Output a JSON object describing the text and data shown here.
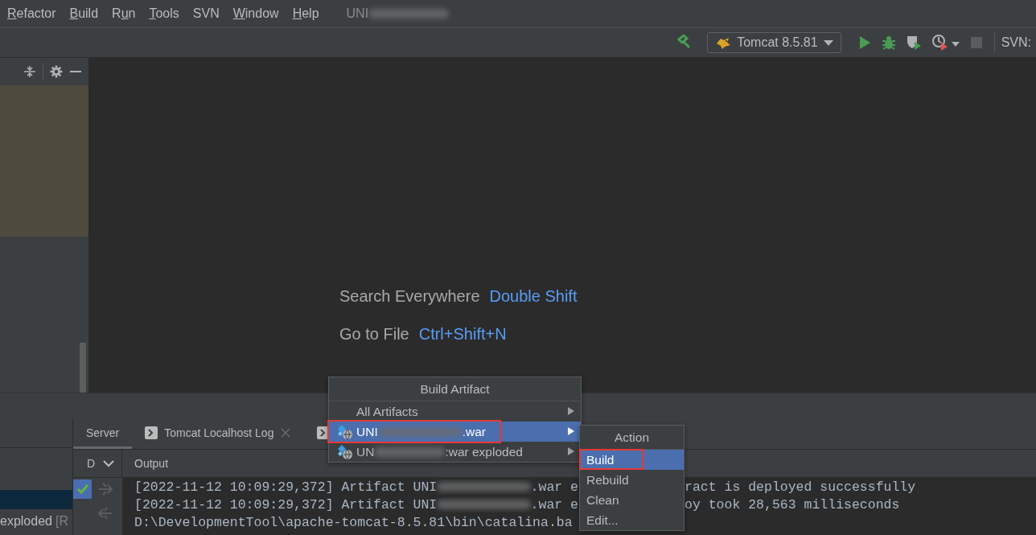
{
  "menu_bar": {
    "items": [
      {
        "key": "R",
        "post": "efactor"
      },
      {
        "key": "B",
        "post": "uild"
      },
      {
        "pre": "R",
        "key": "u",
        "post": "n"
      },
      {
        "key": "T",
        "post": "ools"
      },
      {
        "post": "SVN"
      },
      {
        "key": "W",
        "post": "indow"
      },
      {
        "key": "H",
        "post": "elp"
      }
    ],
    "project_title": {
      "start": "UNI",
      "blurred": true
    }
  },
  "toolbar": {
    "run_config": "Tomcat 8.5.81",
    "stop_disabled": true,
    "vcs_label": "SVN:"
  },
  "editor": {
    "hints": [
      {
        "label": "Search Everywhere",
        "shortcut": "Double Shift"
      },
      {
        "label": "Go to File",
        "shortcut": "Ctrl+Shift+N"
      }
    ]
  },
  "services": {
    "tabs": [
      {
        "label": "Server",
        "selected": true
      },
      {
        "label": "Tomcat Localhost Log",
        "selected": false,
        "closable": true
      },
      {
        "selected": false
      }
    ],
    "column_header": "D",
    "output_header": "Output",
    "left_items": [
      {
        "text": "exploded",
        "suffix": "[R",
        "selected": false
      }
    ],
    "output_lines": [
      {
        "left": [
          {
            "kind": "text",
            "text": "[2022-11-12 10:09:29,372] Artifact UNI"
          },
          {
            "kind": "blur"
          },
          {
            "kind": "text",
            "text": ".war e"
          }
        ],
        "right": "ract is deployed successfully"
      },
      {
        "left": [
          {
            "kind": "text",
            "text": "[2022-11-12 10:09:29,372] Artifact UNI"
          },
          {
            "kind": "blur"
          },
          {
            "kind": "text",
            "text": ".war e"
          }
        ],
        "right": "oy took 28,563 milliseconds"
      },
      {
        "left": [
          {
            "kind": "text",
            "text": "D:\\DevelopmentTool\\apache-tomcat-8.5.81\\bin\\catalina.ba"
          }
        ]
      }
    ]
  },
  "build_artifact_menu": {
    "title": "Build Artifact",
    "items": [
      {
        "kind": "plain",
        "label": "All Artifacts",
        "selected": false,
        "outlined": false
      },
      {
        "kind": "artifact",
        "start": "UNI",
        "end": ".war",
        "selected": true,
        "outlined": true
      },
      {
        "kind": "artifact",
        "start": "UN",
        "end": ":war exploded",
        "selected": false,
        "outlined": false
      }
    ]
  },
  "action_menu": {
    "title": "Action",
    "items": [
      {
        "label": "Build",
        "selected": true,
        "outlined": true
      },
      {
        "label": "Rebuild",
        "selected": false,
        "outlined": false
      },
      {
        "label": "Clean",
        "selected": false,
        "outlined": false
      },
      {
        "label": "Edit...",
        "selected": false,
        "outlined": false
      }
    ]
  }
}
